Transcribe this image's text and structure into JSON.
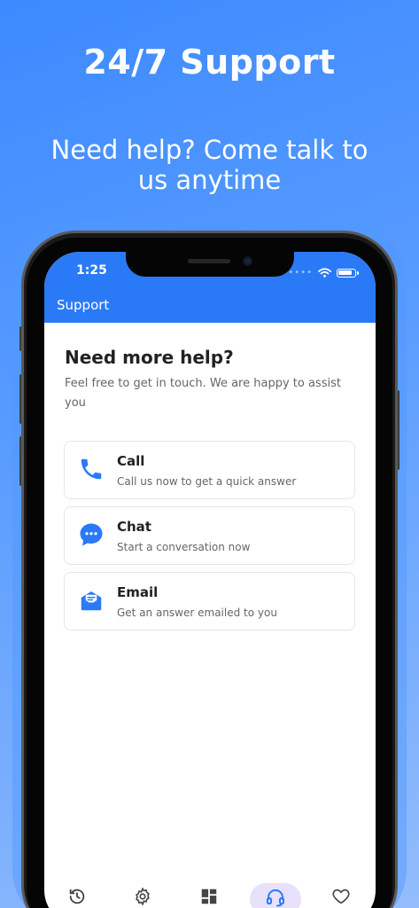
{
  "promo": {
    "headline": "24/7 Support",
    "subline": "Need help? Come talk to us anytime"
  },
  "status_bar": {
    "time": "1:25"
  },
  "app_bar": {
    "title": "Support"
  },
  "main": {
    "heading": "Need more help?",
    "description": "Feel free to get in touch. We are happy to assist you",
    "options": [
      {
        "title": "Call",
        "subtitle": "Call us now to get a quick answer",
        "icon": "phone-icon"
      },
      {
        "title": "Chat",
        "subtitle": "Start a conversation now",
        "icon": "chat-bubble-icon"
      },
      {
        "title": "Email",
        "subtitle": "Get an answer emailed to you",
        "icon": "email-icon"
      }
    ]
  },
  "tab_bar": {
    "tabs": [
      {
        "icon": "history-icon",
        "active": false
      },
      {
        "icon": "gear-icon",
        "active": false
      },
      {
        "icon": "dashboard-icon",
        "active": false
      },
      {
        "icon": "headset-icon",
        "active": true
      },
      {
        "icon": "heart-icon",
        "active": false
      }
    ]
  },
  "colors": {
    "accent": "#2a7af7",
    "active_tab_bg": "#e8e1fb",
    "background_gradient_start": "#3c8aff",
    "background_gradient_end": "#93bdfb"
  }
}
